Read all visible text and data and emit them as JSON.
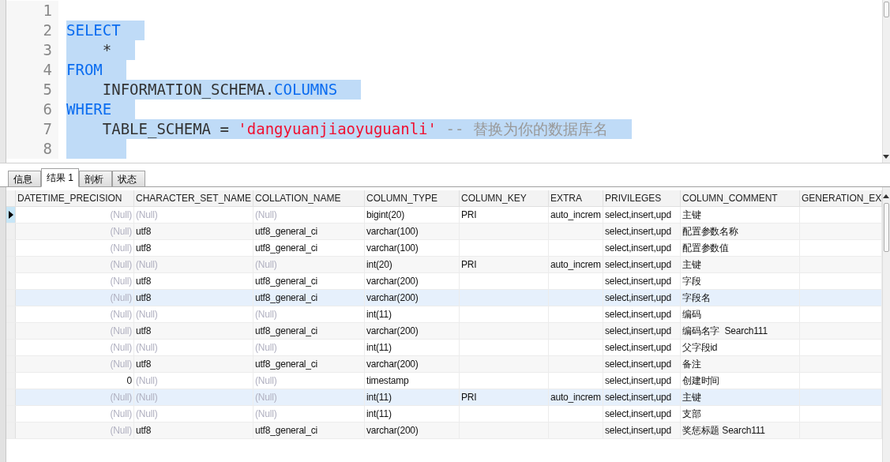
{
  "editor": {
    "lines": [
      {
        "number": "1"
      },
      {
        "number": "2",
        "selected": true,
        "indented": false,
        "tokens": [
          {
            "text": "SELECT",
            "kind": "keyword"
          }
        ]
      },
      {
        "number": "3",
        "selected": true,
        "indented": true,
        "tokens": [
          {
            "text": "*",
            "kind": "plain"
          }
        ]
      },
      {
        "number": "4",
        "selected": true,
        "indented": false,
        "tokens": [
          {
            "text": "FROM",
            "kind": "keyword"
          }
        ]
      },
      {
        "number": "5",
        "selected": true,
        "indented": true,
        "tokens": [
          {
            "text": "INFORMATION_SCHEMA.",
            "kind": "plain"
          },
          {
            "text": "COLUMNS",
            "kind": "keyword"
          }
        ]
      },
      {
        "number": "6",
        "selected": true,
        "indented": false,
        "tokens": [
          {
            "text": "WHERE",
            "kind": "keyword"
          }
        ]
      },
      {
        "number": "7",
        "selected": true,
        "indented": true,
        "tokens": [
          {
            "text": "TABLE_SCHEMA = ",
            "kind": "plain"
          },
          {
            "text": "'dangyuanjiaoyuguanli'",
            "kind": "string"
          },
          {
            "text": " -- 替换为你的数据库名",
            "kind": "comment"
          }
        ]
      },
      {
        "number": "8",
        "selected": true,
        "indented": true
      }
    ]
  },
  "tabs": [
    {
      "label": "信息",
      "selected": false
    },
    {
      "label": "结果 1",
      "selected": true
    },
    {
      "label": "剖析",
      "selected": false
    },
    {
      "label": "状态",
      "selected": false
    }
  ],
  "table": {
    "columns": [
      {
        "label": "DATETIME_PRECISION"
      },
      {
        "label": "CHARACTER_SET_NAME"
      },
      {
        "label": "COLLATION_NAME"
      },
      {
        "label": "COLUMN_TYPE"
      },
      {
        "label": "COLUMN_KEY"
      },
      {
        "label": "EXTRA"
      },
      {
        "label": "PRIVILEGES"
      },
      {
        "label": "COLUMN_COMMENT"
      },
      {
        "label": "GENERATION_EX"
      }
    ],
    "rows": [
      {
        "current": true,
        "highlighted": false,
        "cells": [
          {
            "text": "(Null)",
            "null": true
          },
          {
            "text": "(Null)",
            "null": true
          },
          {
            "text": "(Null)",
            "null": true
          },
          "bigint(20)",
          "PRI",
          "auto_increm",
          "select,insert,upd",
          "主键",
          null
        ]
      },
      {
        "current": false,
        "highlighted": false,
        "cells": [
          {
            "text": "(Null)",
            "null": true
          },
          "utf8",
          "utf8_general_ci",
          "varchar(100)",
          null,
          null,
          "select,insert,upd",
          "配置参数名称",
          null
        ]
      },
      {
        "current": false,
        "highlighted": false,
        "cells": [
          {
            "text": "(Null)",
            "null": true
          },
          "utf8",
          "utf8_general_ci",
          "varchar(100)",
          null,
          null,
          "select,insert,upd",
          "配置参数值",
          null
        ]
      },
      {
        "current": false,
        "highlighted": false,
        "cells": [
          {
            "text": "(Null)",
            "null": true
          },
          {
            "text": "(Null)",
            "null": true
          },
          {
            "text": "(Null)",
            "null": true
          },
          "int(20)",
          "PRI",
          "auto_increm",
          "select,insert,upd",
          "主键",
          null
        ]
      },
      {
        "current": false,
        "highlighted": false,
        "cells": [
          {
            "text": "(Null)",
            "null": true
          },
          "utf8",
          "utf8_general_ci",
          "varchar(200)",
          null,
          null,
          "select,insert,upd",
          "字段",
          null
        ]
      },
      {
        "current": false,
        "highlighted": true,
        "cells": [
          {
            "text": "(Null)",
            "null": true
          },
          "utf8",
          "utf8_general_ci",
          "varchar(200)",
          null,
          null,
          "select,insert,upd",
          "字段名",
          null
        ]
      },
      {
        "current": false,
        "highlighted": false,
        "cells": [
          {
            "text": "(Null)",
            "null": true
          },
          {
            "text": "(Null)",
            "null": true
          },
          {
            "text": "(Null)",
            "null": true
          },
          "int(11)",
          null,
          null,
          "select,insert,upd",
          "编码",
          null
        ]
      },
      {
        "current": false,
        "highlighted": false,
        "cells": [
          {
            "text": "(Null)",
            "null": true
          },
          "utf8",
          "utf8_general_ci",
          "varchar(200)",
          null,
          null,
          "select,insert,upd",
          "编码名字  Search111",
          null
        ]
      },
      {
        "current": false,
        "highlighted": false,
        "cells": [
          {
            "text": "(Null)",
            "null": true
          },
          {
            "text": "(Null)",
            "null": true
          },
          {
            "text": "(Null)",
            "null": true
          },
          "int(11)",
          null,
          null,
          "select,insert,upd",
          "父字段id",
          null
        ]
      },
      {
        "current": false,
        "highlighted": false,
        "cells": [
          {
            "text": "(Null)",
            "null": true
          },
          "utf8",
          "utf8_general_ci",
          "varchar(200)",
          null,
          null,
          "select,insert,upd",
          "备注",
          null
        ]
      },
      {
        "current": false,
        "highlighted": false,
        "cells": [
          "0",
          {
            "text": "(Null)",
            "null": true
          },
          {
            "text": "(Null)",
            "null": true
          },
          "timestamp",
          null,
          null,
          "select,insert,upd",
          "创建时间",
          null
        ]
      },
      {
        "current": false,
        "highlighted": true,
        "cells": [
          {
            "text": "(Null)",
            "null": true
          },
          {
            "text": "(Null)",
            "null": true
          },
          {
            "text": "(Null)",
            "null": true
          },
          "int(11)",
          "PRI",
          "auto_increm",
          "select,insert,upd",
          "主键",
          null
        ]
      },
      {
        "current": false,
        "highlighted": false,
        "cells": [
          {
            "text": "(Null)",
            "null": true
          },
          {
            "text": "(Null)",
            "null": true
          },
          {
            "text": "(Null)",
            "null": true
          },
          "int(11)",
          null,
          null,
          "select,insert,upd",
          "支部",
          null
        ]
      },
      {
        "current": false,
        "highlighted": false,
        "cells": [
          {
            "text": "(Null)",
            "null": true
          },
          "utf8",
          "utf8_general_ci",
          "varchar(200)",
          null,
          null,
          "select,insert,upd",
          "奖惩标题 Search111",
          null
        ]
      }
    ]
  }
}
